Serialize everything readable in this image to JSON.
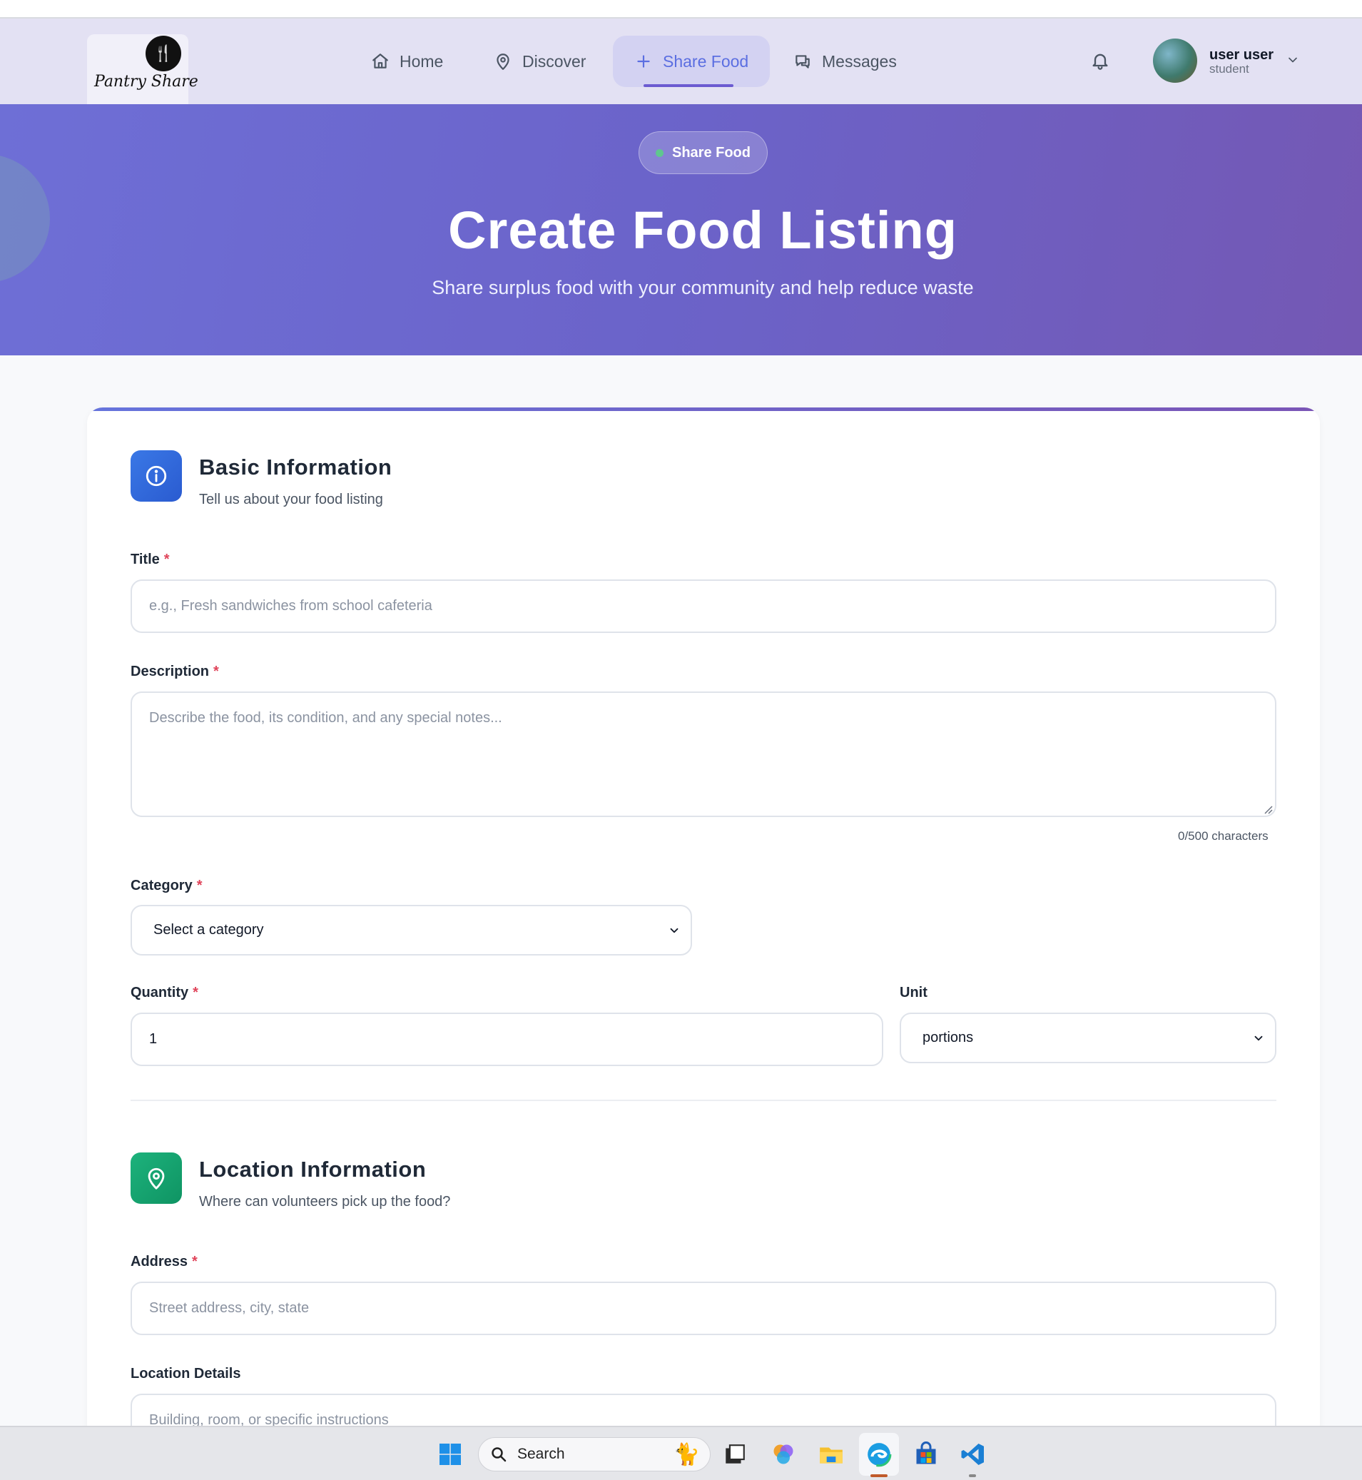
{
  "brand": {
    "logo_text": "Pantry Share"
  },
  "nav": {
    "items": [
      {
        "label": "Home",
        "icon": "home-icon"
      },
      {
        "label": "Discover",
        "icon": "map-pin-icon"
      },
      {
        "label": "Share Food",
        "icon": "plus-icon",
        "active": true
      },
      {
        "label": "Messages",
        "icon": "chat-icon"
      }
    ],
    "user": {
      "name": "user user",
      "role": "student"
    }
  },
  "hero": {
    "badge": "Share Food",
    "title": "Create Food Listing",
    "subtitle": "Share surplus food with your community and help reduce waste"
  },
  "basic": {
    "title": "Basic Information",
    "desc": "Tell us about your food listing",
    "title_label": "Title",
    "title_placeholder": "e.g., Fresh sandwiches from school cafeteria",
    "description_label": "Description",
    "description_placeholder": "Describe the food, its condition, and any special notes...",
    "char_count": "0/500 characters",
    "category_label": "Category",
    "category_value": "Select a category",
    "quantity_label": "Quantity",
    "quantity_value": "1",
    "unit_label": "Unit",
    "unit_value": "portions",
    "required_mark": "*"
  },
  "location": {
    "title": "Location Information",
    "desc": "Where can volunteers pick up the food?",
    "address_label": "Address",
    "address_placeholder": "Street address, city, state",
    "details_label": "Location Details",
    "details_placeholder": "Building, room, or specific instructions"
  },
  "taskbar": {
    "search_label": "Search"
  },
  "colors": {
    "accent": "#5b6ee1",
    "hero_start": "#6e6fd6",
    "hero_end": "#7458b4",
    "info_icon_bg": "#2f66d8",
    "location_icon_bg": "#14a06e",
    "required": "#e0445a"
  }
}
